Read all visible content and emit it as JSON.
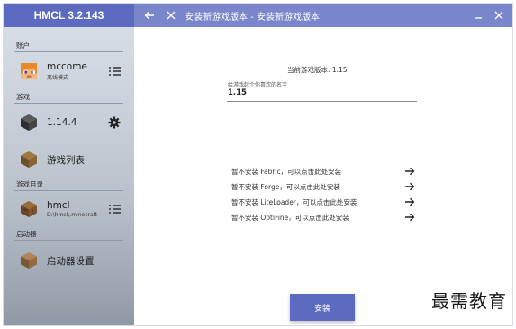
{
  "app": {
    "title": "HMCL 3.2.143"
  },
  "titlebar": {
    "title": "安装新游戏版本 - 安装新游戏版本",
    "back_icon": "arrow-left-icon",
    "close_icon": "close-icon",
    "minimize_icon": "minimize-icon",
    "exit_icon": "close-icon"
  },
  "sidebar": {
    "account_section": "账户",
    "account": {
      "name": "mccome",
      "mode": "离线模式"
    },
    "game_section": "游戏",
    "game_version": "1.14.4",
    "game_list": "游戏列表",
    "dir_section": "游戏目录",
    "dir": {
      "name": "hmcl",
      "path": "D:\\hmcl\\.minecraft"
    },
    "launcher_section": "启动器",
    "launcher_settings": "启动器设置"
  },
  "main": {
    "current_version": "当前游戏版本: 1.15",
    "name_hint": "给游戏起个你喜欢的名字",
    "name_value": "1.15",
    "mods": [
      "暂不安装 Fabric，可以点击此处安装",
      "暂不安装 Forge，可以点击此处安装",
      "暂不安装 LiteLoader，可以点击此处安装",
      "暂不安装 OptiFine，可以点击此处安装"
    ],
    "install_label": "安装"
  },
  "watermark": "最需教育",
  "colors": {
    "primary": "#5c6bc0",
    "titlebar": "#7986cb"
  }
}
